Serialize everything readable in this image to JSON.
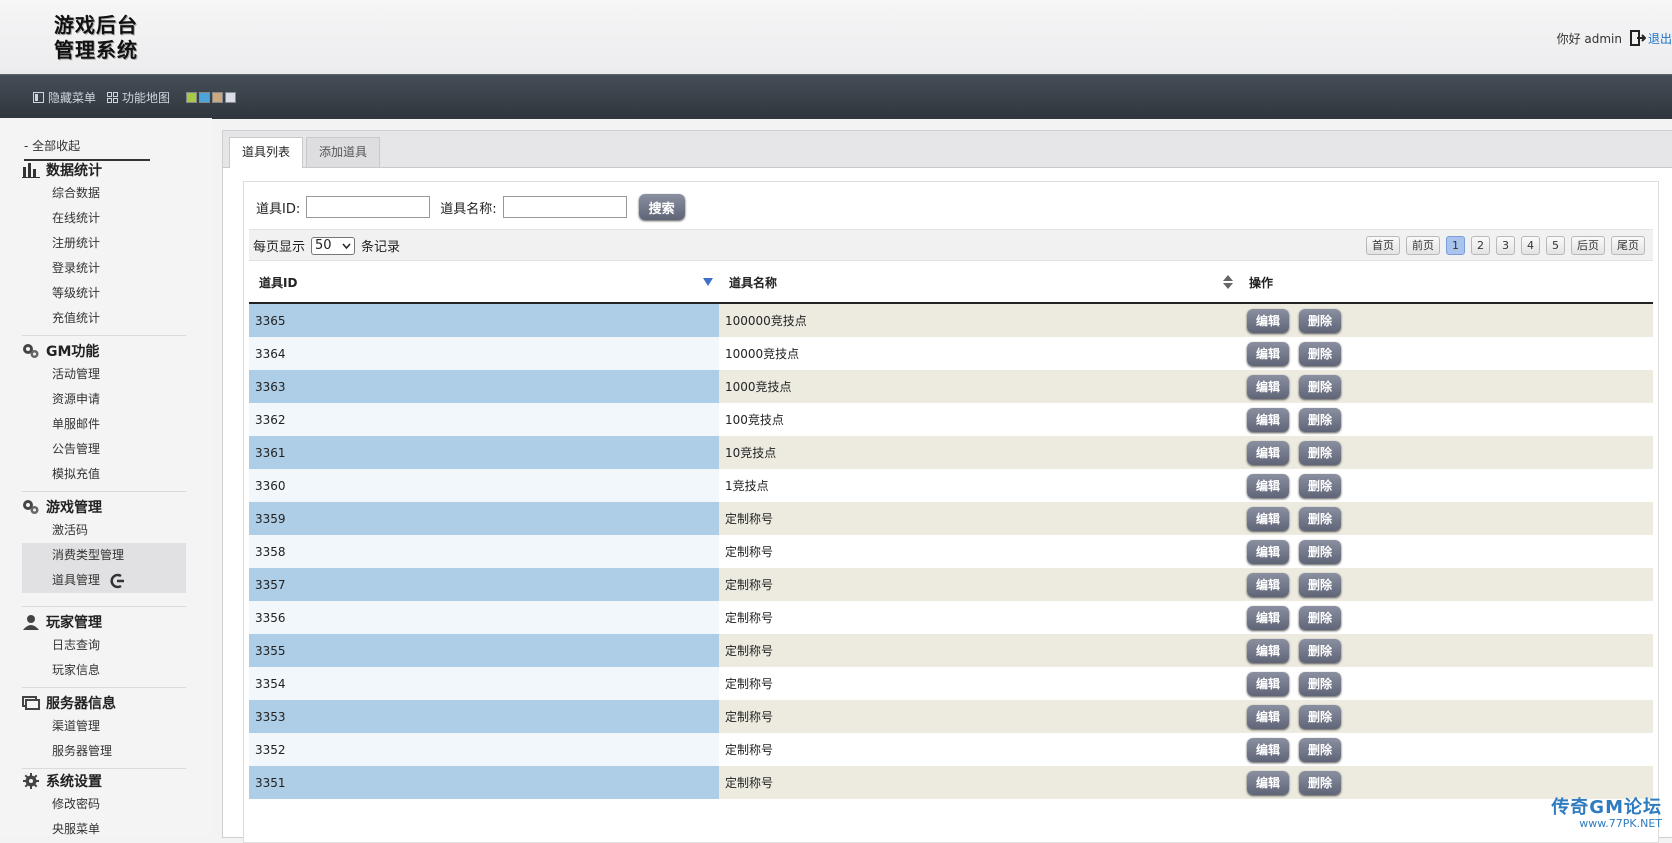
{
  "app": {
    "logo_text_line1": "游戏后台",
    "logo_text_line2": "管理系统",
    "greeting": "你好 admin",
    "logout": "退出"
  },
  "toolbar": {
    "hide_menu": "隐藏菜单",
    "function_map": "功能地图",
    "theme_colors": [
      "#a6c94a",
      "#4ea3d8",
      "#c9a882",
      "#d9dde4"
    ]
  },
  "sidebar": {
    "collapse_all": "- 全部收起",
    "groups": [
      {
        "title": "数据统计",
        "icon": "bar-chart-icon",
        "items": [
          "综合数据",
          "在线统计",
          "注册统计",
          "登录统计",
          "等级统计",
          "充值统计"
        ]
      },
      {
        "title": "GM功能",
        "icon": "gears-icon",
        "items": [
          "活动管理",
          "资源申请",
          "单服邮件",
          "公告管理",
          "模拟充值"
        ]
      },
      {
        "title": "游戏管理",
        "icon": "gears-icon",
        "items": [
          "激活码",
          "消费类型管理",
          "道具管理"
        ]
      },
      {
        "title": "玩家管理",
        "icon": "user-icon",
        "items": [
          "日志查询",
          "玩家信息"
        ]
      },
      {
        "title": "服务器信息",
        "icon": "server-icon",
        "items": [
          "渠道管理",
          "服务器管理"
        ]
      },
      {
        "title": "系统设置",
        "icon": "gear-icon",
        "items": [
          "修改密码",
          "央服菜单"
        ]
      }
    ]
  },
  "tabs": [
    "道具列表",
    "添加道具"
  ],
  "search": {
    "id_label": "道具ID:",
    "name_label": "道具名称:",
    "button": "搜索"
  },
  "paging": {
    "show_prefix": "每页显示",
    "page_size": "50",
    "show_suffix": "条记录",
    "first": "首页",
    "prev": "前页",
    "pages": [
      "1",
      "2",
      "3",
      "4",
      "5"
    ],
    "current": "1",
    "next": "后页",
    "last": "尾页"
  },
  "table": {
    "headers": [
      "道具ID",
      "道具名称",
      "操作"
    ],
    "edit_label": "编辑",
    "delete_label": "删除",
    "rows": [
      [
        "3365",
        "100000竞技点"
      ],
      [
        "3364",
        "10000竞技点"
      ],
      [
        "3363",
        "1000竞技点"
      ],
      [
        "3362",
        "100竞技点"
      ],
      [
        "3361",
        "10竞技点"
      ],
      [
        "3360",
        "1竞技点"
      ],
      [
        "3359",
        "定制称号"
      ],
      [
        "3358",
        "定制称号"
      ],
      [
        "3357",
        "定制称号"
      ],
      [
        "3356",
        "定制称号"
      ],
      [
        "3355",
        "定制称号"
      ],
      [
        "3354",
        "定制称号"
      ],
      [
        "3353",
        "定制称号"
      ],
      [
        "3352",
        "定制称号"
      ],
      [
        "3351",
        "定制称号"
      ]
    ]
  },
  "watermark": {
    "title": "传奇GM论坛",
    "url": "www.77PK.NET"
  }
}
